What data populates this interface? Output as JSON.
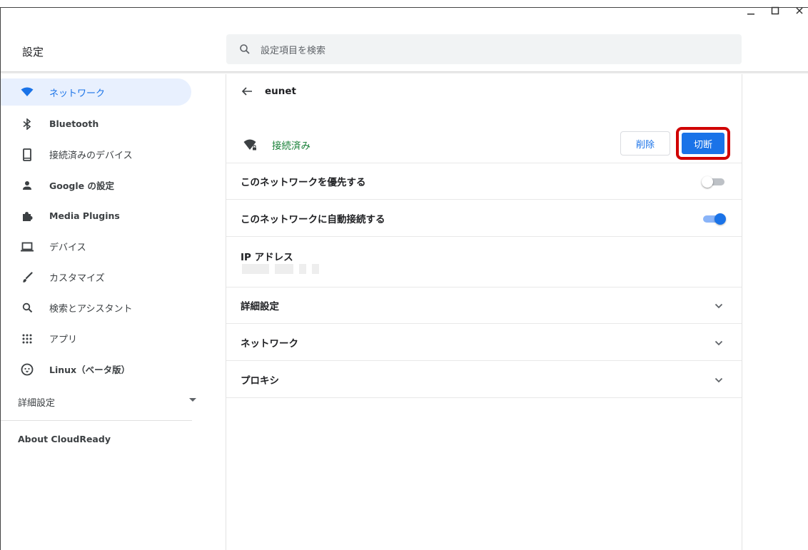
{
  "app": {
    "title": "設定"
  },
  "window_controls": {
    "minimize": "minimize-icon",
    "maximize": "maximize-icon",
    "close": "close-icon"
  },
  "search": {
    "placeholder": "設定項目を検索",
    "icon": "search-icon"
  },
  "sidebar": {
    "items": [
      {
        "label": "ネットワーク",
        "icon": "wifi-icon",
        "active": true
      },
      {
        "label": "Bluetooth",
        "icon": "bluetooth-icon"
      },
      {
        "label": "接続済みのデバイス",
        "icon": "phone-icon"
      },
      {
        "label": "Google の設定",
        "icon": "person-icon"
      },
      {
        "label": "Media Plugins",
        "icon": "puzzle-icon"
      },
      {
        "label": "デバイス",
        "icon": "laptop-icon"
      },
      {
        "label": "カスタマイズ",
        "icon": "brush-icon"
      },
      {
        "label": "検索とアシスタント",
        "icon": "search-icon"
      },
      {
        "label": "アプリ",
        "icon": "apps-grid-icon"
      },
      {
        "label": "Linux（ベータ版）",
        "icon": "penguin-icon"
      }
    ],
    "advanced": "詳細設定",
    "about": "About CloudReady"
  },
  "network": {
    "name": "eunet",
    "status": "接続済み",
    "forget_button": "削除",
    "disconnect_button": "切断",
    "prefer_label": "このネットワークを優先する",
    "prefer_enabled": false,
    "autoconnect_label": "このネットワークに自動接続する",
    "autoconnect_enabled": true,
    "ip_label": "IP アドレス",
    "sections": [
      "詳細設定",
      "ネットワーク",
      "プロキシ"
    ]
  },
  "colors": {
    "accent": "#1a73e8",
    "connected": "#188038",
    "highlight": "#d00000",
    "active_bg": "#e8f0fe"
  }
}
